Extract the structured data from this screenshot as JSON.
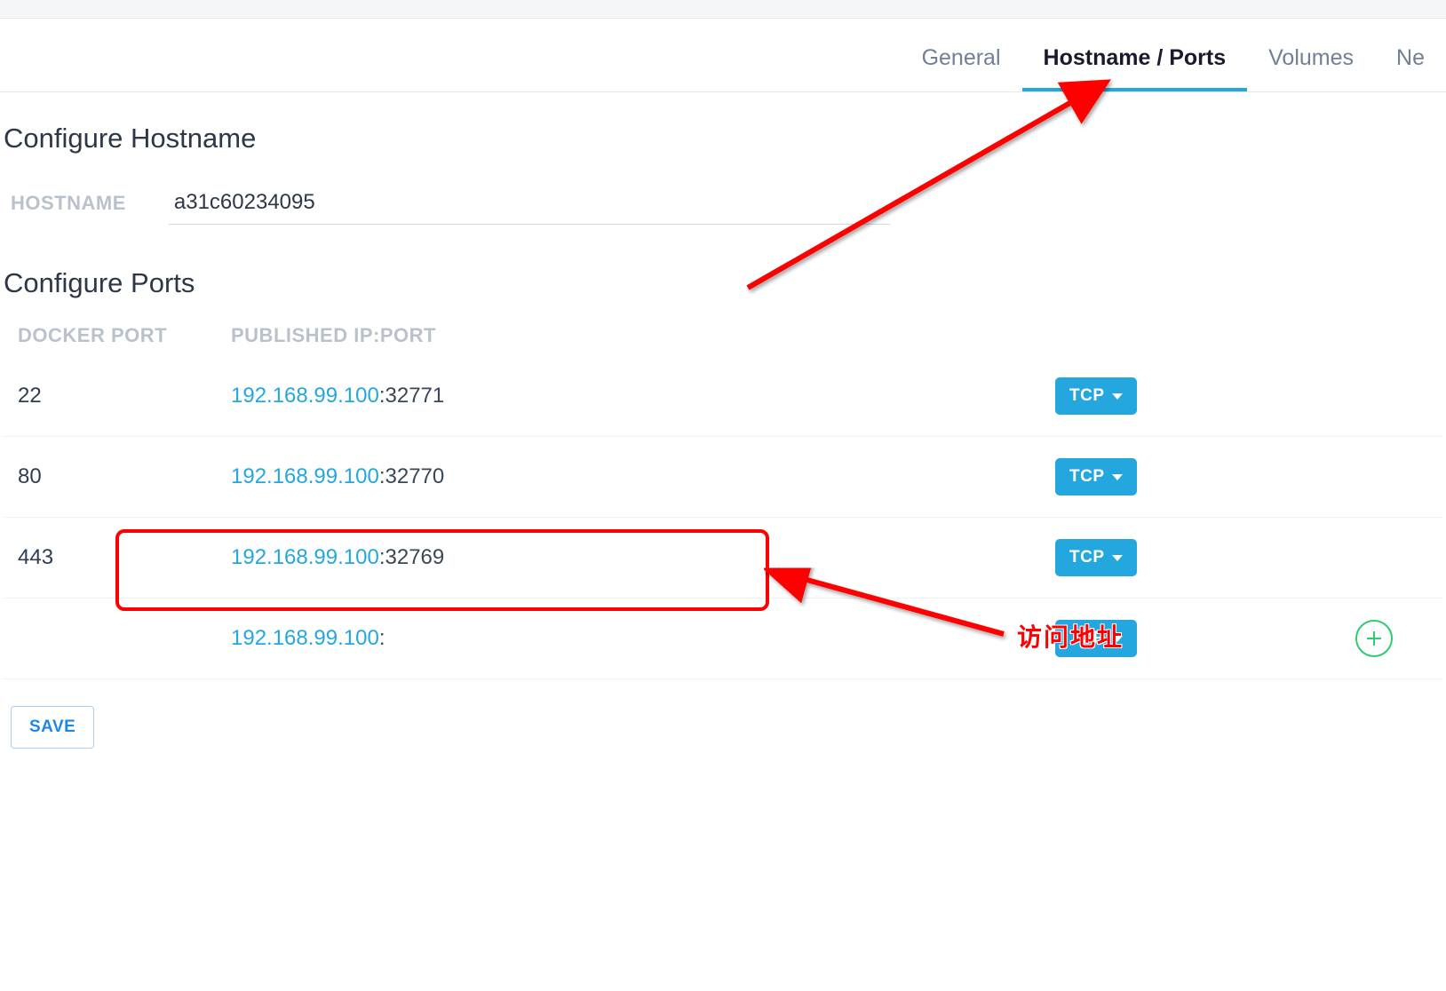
{
  "tabs": {
    "general": "General",
    "hostname_ports": "Hostname / Ports",
    "volumes": "Volumes",
    "network": "Ne"
  },
  "hostname": {
    "title": "Configure Hostname",
    "label": "HOSTNAME",
    "value": "a31c60234095"
  },
  "ports": {
    "title": "Configure Ports",
    "col_docker": "DOCKER PORT",
    "col_published": "PUBLISHED IP:PORT",
    "rows": [
      {
        "docker_port": "22",
        "ip": "192.168.99.100",
        "sep": ":",
        "host_port": "32771",
        "protocol": "TCP"
      },
      {
        "docker_port": "80",
        "ip": "192.168.99.100",
        "sep": ":",
        "host_port": "32770",
        "protocol": "TCP"
      },
      {
        "docker_port": "443",
        "ip": "192.168.99.100",
        "sep": ":",
        "host_port": "32769",
        "protocol": "TCP"
      },
      {
        "docker_port": "",
        "ip": "192.168.99.100",
        "sep": ":",
        "host_port": "",
        "protocol": "TCP"
      }
    ]
  },
  "save_label": "SAVE",
  "annot_label": "访问地址"
}
